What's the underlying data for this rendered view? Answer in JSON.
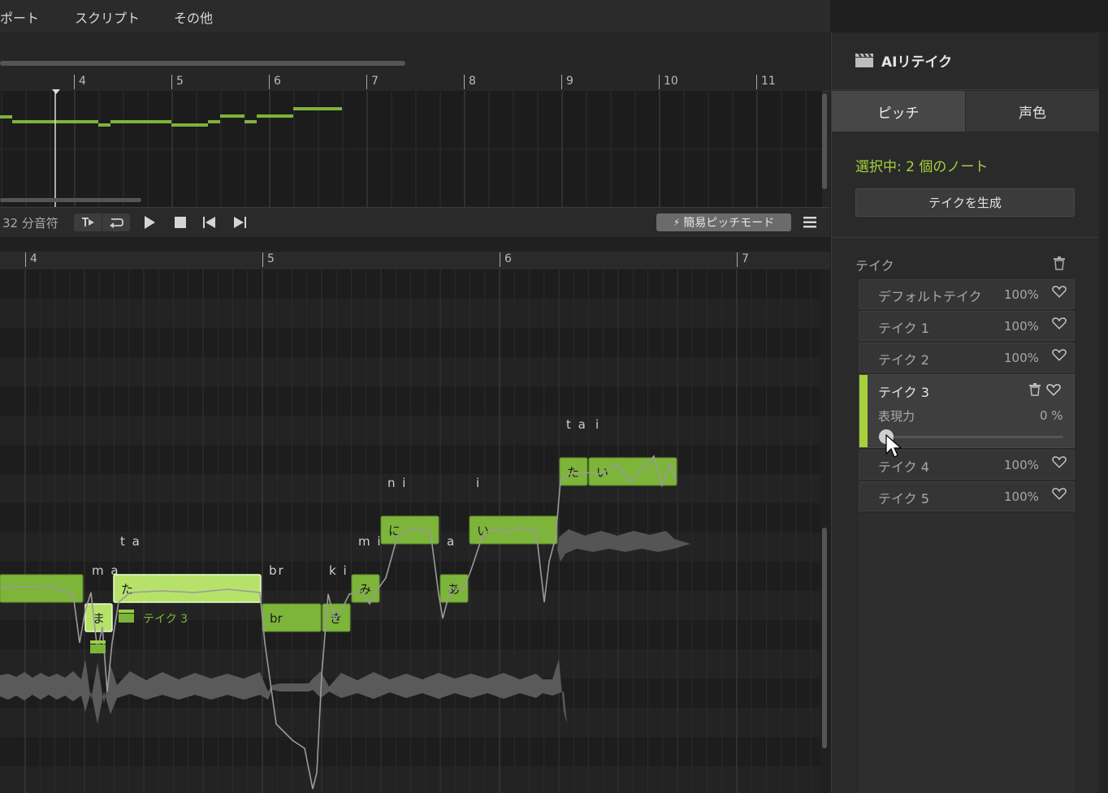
{
  "menu": {
    "items": [
      "ポート",
      "スクリプト",
      "その他"
    ]
  },
  "overview": {
    "ruler": [
      "4",
      "5",
      "6",
      "7",
      "8",
      "9",
      "10",
      "11"
    ]
  },
  "transport": {
    "quantize": "32 分音符",
    "simple_pitch_mode": "簡易ピッチモード"
  },
  "editor": {
    "ruler": [
      "4",
      "5",
      "6",
      "7"
    ],
    "notes": [
      {
        "lyric": "",
        "text": "",
        "selected": false
      },
      {
        "lyric": "m a",
        "text": "ま",
        "selected": true
      },
      {
        "lyric": "t a",
        "text": "た",
        "selected": true
      },
      {
        "lyric": "br",
        "text": "br",
        "selected": false
      },
      {
        "lyric": "k i",
        "text": "き",
        "selected": false
      },
      {
        "lyric": "m i",
        "text": "み",
        "selected": false
      },
      {
        "lyric": "a",
        "text": "あ",
        "selected": false
      },
      {
        "lyric": "n i",
        "text": "に",
        "selected": false
      },
      {
        "lyric": "i",
        "text": "い",
        "selected": false
      },
      {
        "lyric": "t a",
        "text": "た",
        "selected": false
      },
      {
        "lyric": "i",
        "text": "い",
        "selected": false
      }
    ],
    "take_tag": "テイク 3"
  },
  "panel": {
    "title": "AIリテイク",
    "tabs": [
      "ピッチ",
      "声色"
    ],
    "selected_info": "選択中: 2 個のノート",
    "generate_button": "テイクを生成",
    "takes_header": "テイク",
    "takes": [
      {
        "name": "デフォルトテイク",
        "percent": "100%"
      },
      {
        "name": "テイク 1",
        "percent": "100%"
      },
      {
        "name": "テイク 2",
        "percent": "100%"
      },
      {
        "name": "テイク 3",
        "percent": "",
        "expanded": true
      },
      {
        "name": "テイク 4",
        "percent": "100%"
      },
      {
        "name": "テイク 5",
        "percent": "100%"
      }
    ],
    "expression_label": "表現力",
    "expression_value": "0 %",
    "expression_level": 0
  },
  "colors": {
    "accent": "#a6d03c",
    "note": "#7db43a",
    "note_selected": "#b6e26a",
    "panel_bg": "#2a2a2a"
  }
}
